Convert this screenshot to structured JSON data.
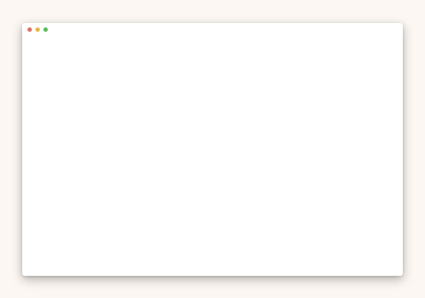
{
  "window": {
    "controls": [
      {
        "name": "close-button",
        "icon": "close-dot-icon",
        "color": "#e0665a"
      },
      {
        "name": "minimize-button",
        "icon": "minimize-dot-icon",
        "color": "#e8b03e"
      },
      {
        "name": "maximize-button",
        "icon": "maximize-dot-icon",
        "color": "#4cb94f"
      }
    ]
  },
  "colors": {
    "desktop_background": "#fcf7f2",
    "window_background": "#ffffff"
  }
}
